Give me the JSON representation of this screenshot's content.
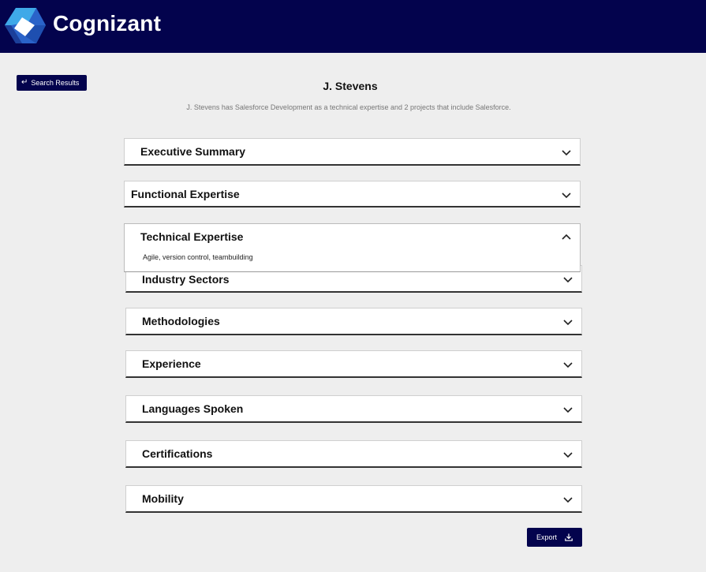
{
  "header": {
    "brand": "Cognizant",
    "logo_icon": "cognizant-logo-icon"
  },
  "nav": {
    "back_label": "Search Results",
    "back_icon": "return-arrow-icon"
  },
  "profile": {
    "name": "J. Stevens",
    "summary": "J. Stevens has Salesforce Development as a technical expertise and 2 projects that include Salesforce."
  },
  "sections": [
    {
      "label": "Executive Summary",
      "expanded": false
    },
    {
      "label": "Functional Expertise",
      "expanded": false
    },
    {
      "label": "Technical Expertise",
      "expanded": true,
      "content": "Agile, version control, teambuilding"
    },
    {
      "label": "Industry Sectors",
      "expanded": false
    },
    {
      "label": "Methodologies",
      "expanded": false
    },
    {
      "label": "Experience",
      "expanded": false
    },
    {
      "label": "Languages Spoken",
      "expanded": false
    },
    {
      "label": "Certifications",
      "expanded": false
    },
    {
      "label": "Mobility",
      "expanded": false
    }
  ],
  "actions": {
    "export_label": "Export",
    "export_icon": "download-icon"
  },
  "colors": {
    "brand_navy": "#03034d",
    "page_bg": "#eeeeee"
  }
}
